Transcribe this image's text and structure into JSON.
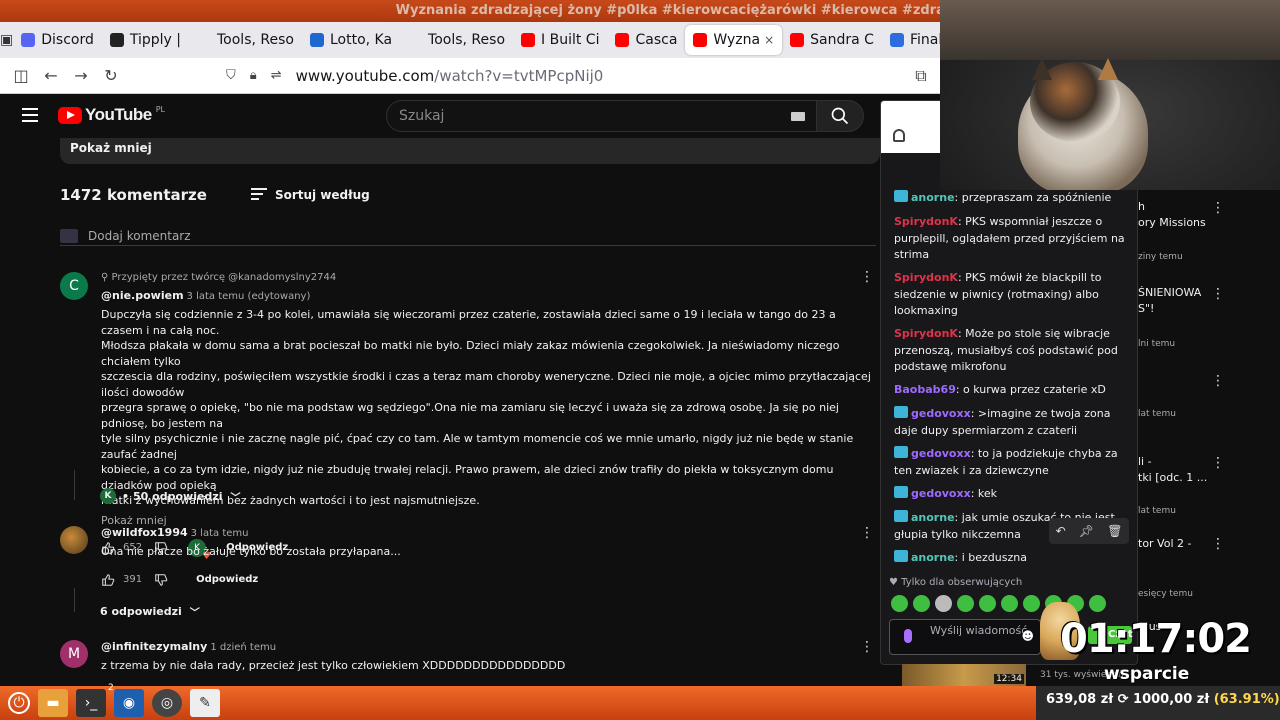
{
  "os_title": "Wyznania zdradzającej żony #p0lka #kierowcaciężarówki #kierowca #zdrada #kobiety #piekłokobiet - YouTube — M",
  "tabs": [
    {
      "label": "Discord",
      "color": "#5865f2"
    },
    {
      "label": "Tipply |",
      "color": "#222222"
    },
    {
      "label": "Tools, Reso",
      "color": "#e9e9ed"
    },
    {
      "label": "Lotto, Ka",
      "color": "#1e66d0"
    },
    {
      "label": "Tools, Reso",
      "color": "#e9e9ed"
    },
    {
      "label": "I Built Ci",
      "color": "#ff0000"
    },
    {
      "label": "Casca",
      "color": "#ff0000"
    },
    {
      "label": "Wyzna",
      "color": "#ff0000",
      "active": true,
      "close": "×"
    },
    {
      "label": "Sandra C",
      "color": "#ff0000"
    },
    {
      "label": "FinalBlac",
      "color": "#2d6cdf"
    }
  ],
  "address": {
    "host": "www.youtube.com",
    "path": "/watch?v=tvtMPcpNij0"
  },
  "youtube": {
    "logo_text": "YouTube",
    "region": "PL",
    "search_placeholder": "Szukaj"
  },
  "description": {
    "show_less": "Pokaż mniej"
  },
  "comments": {
    "count_label": "1472 komentarze",
    "sort_label": "Sortuj według",
    "add_placeholder": "Dodaj komentarz",
    "items": [
      {
        "avatar_letter": "C",
        "pinned": "Przypięty przez twórcę @kanadomyslny2744",
        "author": "@nie.powiem",
        "time": "3 lata temu (edytowany)",
        "text": "Dupczyła się codziennie z 3-4 po kolei, umawiała się wieczorami przez czaterie, zostawiała dzieci same o 19 i leciała w tango do 23 a czasem i na całą noc.\nMłodsza płakała w domu sama a brat pocieszał bo matki nie było. Dzieci miały zakaz mówienia czegokolwiek. Ja nieświadomy niczego chciałem tylko\nszczescia dla rodziny, poświęciłem wszystkie środki i czas a teraz mam choroby weneryczne. Dzieci nie moje, a ojciec mimo przytłaczającej ilości  dowodów\nprzegra sprawę o opiekę, \"bo nie ma podstaw wg sędziego\".Ona nie ma zamiaru się leczyć i uważa się za zdrową osobę. Ja się po niej pdniosę, bo jestem na\ntyle silny psychicznie i nie zacznę nagle pić, ćpać czy co tam. Ale  w tamtym momencie coś we mnie umarło, nigdy już nie będę w stanie zaufać żadnej\nkobiecie, a co za tym idzie, nigdy już nie zbuduję trwałej relacji. Prawo prawem, ale dzieci znów trafiły do piekła w toksycznym domu dziadków  pod opieką\nmatki z wychowaniem bez żadnych wartości i to jest najsmutniejsze.",
        "show_less": "Pokaż mniej",
        "likes": "652",
        "reply": "Odpowiedz",
        "heart_letter": "K",
        "replies_label": "50 odpowiedzi",
        "reply_avatar": "K"
      },
      {
        "author": "@wildfox1994",
        "time": "3 lata temu",
        "text": "Ona nie płacze bo żałuje tylko bo została przyłapana...",
        "likes": "391",
        "reply": "Odpowiedz",
        "replies_label": "6 odpowiedzi"
      },
      {
        "avatar_letter": "M",
        "author": "@infinitezymalny",
        "time": "1 dzień temu",
        "text": "z trzema by nie dała rady, przecież jest tylko człowiekiem XDDDDDDDDDDDDDDDD"
      }
    ]
  },
  "chat": {
    "messages": [
      {
        "user": "anorne",
        "color": "cyan",
        "badge": true,
        "text": "przepraszam za spóźnienie"
      },
      {
        "user": "SpirydonK",
        "color": "red",
        "badge": false,
        "text": "PKS wspomniał jeszcze o purplepill, oglądałem przed przyjściem na strima"
      },
      {
        "user": "SpirydonK",
        "color": "red",
        "badge": false,
        "text": "PKS mówił że blackpill to siedzenie w piwnicy (rotmaxing) albo lookmaxing"
      },
      {
        "user": "SpirydonK",
        "color": "red",
        "badge": false,
        "text": "Może po stole się wibracje przenoszą, musiałbyś coś podstawić pod podstawę mikrofonu"
      },
      {
        "user": "Baobab69",
        "color": "purple",
        "badge": false,
        "text": "o kurwa przez czaterie xD"
      },
      {
        "user": "gedovoxx",
        "color": "purple",
        "badge": true,
        "text": ">imagine ze twoja zona daje dupy spermiarzom z czaterii"
      },
      {
        "user": "gedovoxx",
        "color": "purple",
        "badge": true,
        "text": "to ja podziekuje chyba za ten zwiazek i za dziewczyne"
      },
      {
        "user": "gedovoxx",
        "color": "purple",
        "badge": true,
        "text": "kek"
      },
      {
        "user": "anorne",
        "color": "cyan",
        "badge": true,
        "text": "jak umie oszukać to nie jest głupia tylko nikczemna"
      },
      {
        "user": "anorne",
        "color": "cyan",
        "badge": true,
        "text": "i bezduszna"
      }
    ],
    "followers_only": "Tylko dla obserwujących",
    "input_placeholder": "Wyślij wiadomość"
  },
  "recommendations": [
    {
      "title": "h",
      "meta": ""
    },
    {
      "title": "ory Missions",
      "meta": "ziny temu"
    },
    {
      "title": "ŚNIENIOWA",
      "meta": ""
    },
    {
      "title": "S\"!",
      "meta": "lni temu"
    },
    {
      "title": "",
      "meta": "lat temu"
    },
    {
      "title": "li -",
      "meta": ""
    },
    {
      "title": "tki [odc. 1 ...",
      "meta": "lat temu"
    },
    {
      "title": "tor Vol  2 -",
      "meta": ""
    },
    {
      "title": "",
      "meta": "esięcy temu"
    },
    {
      "title": "musik",
      "meta": ""
    }
  ],
  "overlay": {
    "timer": "01:17:02",
    "support_label": "wsparcie",
    "thumb_duration": "12:34",
    "thumb_meta": "31 tys. wyświetleń",
    "green_label": "Czat",
    "money": "639,08 zł ⟳ 1000,00 zł",
    "money_pct": "(63.91%)"
  },
  "taskbar": {
    "badge": "2"
  }
}
